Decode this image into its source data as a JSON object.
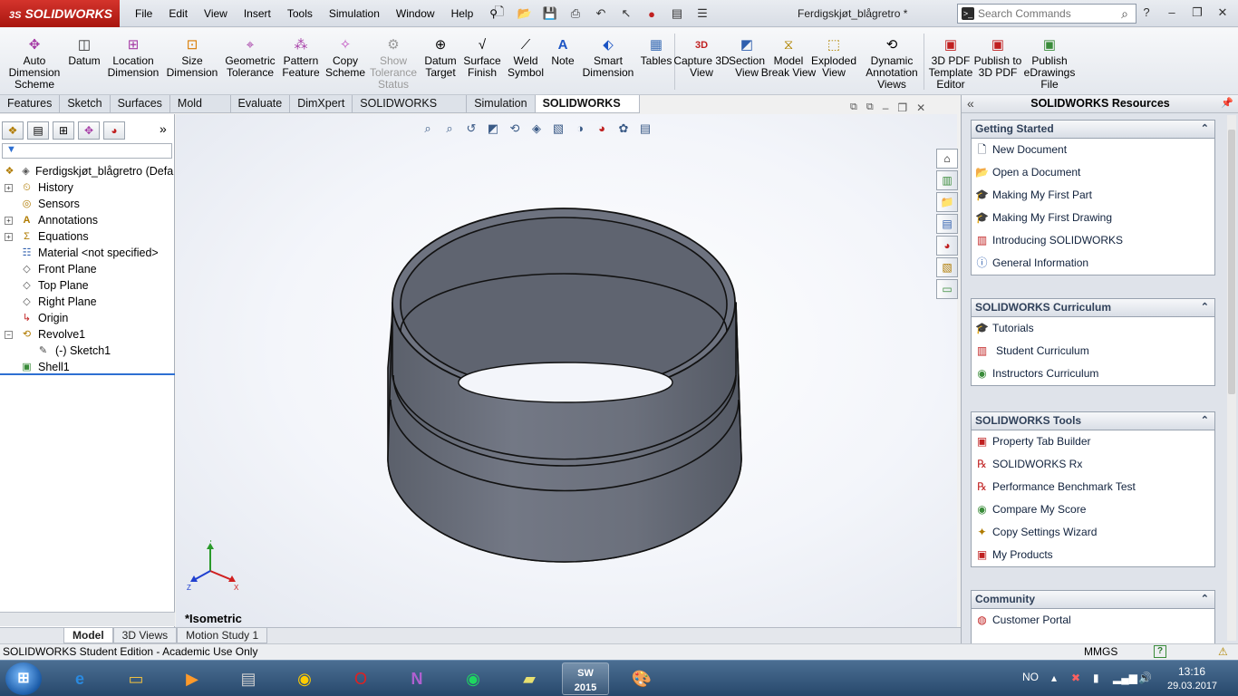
{
  "titlebar": {
    "brand": "SOLIDWORKS",
    "menu": [
      "File",
      "Edit",
      "View",
      "Insert",
      "Tools",
      "Simulation",
      "Window",
      "Help"
    ],
    "document_title": "Ferdigskjøt_blågretro *",
    "search_placeholder": "Search Commands"
  },
  "command_manager": {
    "tools": [
      {
        "label": "Auto Dimension Scheme",
        "icon": "auto-dimension-icon"
      },
      {
        "label": "Datum",
        "icon": "datum-icon"
      },
      {
        "label": "Location Dimension",
        "icon": "location-dimension-icon"
      },
      {
        "label": "Size Dimension",
        "icon": "size-dimension-icon"
      },
      {
        "label": "Geometric Tolerance",
        "icon": "geometric-tolerance-icon"
      },
      {
        "label": "Pattern Feature",
        "icon": "pattern-feature-icon"
      },
      {
        "label": "Copy Scheme",
        "icon": "copy-scheme-icon"
      },
      {
        "label": "Show Tolerance Status",
        "icon": "tolerance-status-icon"
      },
      {
        "label": "Datum Target",
        "icon": "datum-target-icon"
      },
      {
        "label": "Surface Finish",
        "icon": "surface-finish-icon"
      },
      {
        "label": "Weld Symbol",
        "icon": "weld-symbol-icon"
      },
      {
        "label": "Note",
        "icon": "note-icon"
      },
      {
        "label": "Smart Dimension",
        "icon": "smart-dimension-icon"
      },
      {
        "label": "Tables",
        "icon": "tables-icon"
      },
      {
        "label": "Capture 3D View",
        "icon": "capture-3d-view-icon"
      },
      {
        "label": "Section View",
        "icon": "section-view-icon"
      },
      {
        "label": "Model Break View",
        "icon": "model-break-view-icon"
      },
      {
        "label": "Exploded View",
        "icon": "exploded-view-icon"
      },
      {
        "label": "Dynamic Annotation Views",
        "icon": "dynamic-annotation-views-icon"
      },
      {
        "label": "3D PDF Template Editor",
        "icon": "3d-pdf-template-icon"
      },
      {
        "label": "Publish to 3D PDF",
        "icon": "publish-3d-pdf-icon"
      },
      {
        "label": "Publish eDrawings File",
        "icon": "publish-edrawings-icon"
      }
    ]
  },
  "tabs": [
    "Features",
    "Sketch",
    "Surfaces",
    "Mold Tools",
    "Evaluate",
    "DimXpert",
    "SOLIDWORKS Add-Ins",
    "Simulation",
    "SOLIDWORKS MBD"
  ],
  "active_tab": "SOLIDWORKS MBD",
  "feature_tree": {
    "root": "Ferdigskjøt_blågretro  (Defa",
    "items": [
      {
        "label": "History",
        "icon": "history-icon"
      },
      {
        "label": "Sensors",
        "icon": "sensors-icon"
      },
      {
        "label": "Annotations",
        "icon": "annotations-icon"
      },
      {
        "label": "Equations",
        "icon": "equations-icon"
      },
      {
        "label": "Material <not specified>",
        "icon": "material-icon"
      },
      {
        "label": "Front Plane",
        "icon": "plane-icon"
      },
      {
        "label": "Top Plane",
        "icon": "plane-icon"
      },
      {
        "label": "Right Plane",
        "icon": "plane-icon"
      },
      {
        "label": "Origin",
        "icon": "origin-icon"
      },
      {
        "label": "Revolve1",
        "icon": "revolve-icon"
      },
      {
        "label": "(-) Sketch1",
        "icon": "sketch-icon"
      },
      {
        "label": "Shell1",
        "icon": "shell-icon"
      }
    ]
  },
  "graphics": {
    "view_name": "*Isometric",
    "model_color": "#6f7480"
  },
  "bottom_tabs": [
    "Model",
    "3D Views",
    "Motion Study 1"
  ],
  "status": {
    "left": "SOLIDWORKS Student Edition - Academic Use Only",
    "units": "MMGS",
    "help": "?"
  },
  "resources": {
    "title": "SOLIDWORKS Resources",
    "groups": [
      {
        "title": "Getting Started",
        "items": [
          "New Document",
          "Open a Document",
          "Making My First Part",
          "Making My First Drawing",
          "Introducing SOLIDWORKS",
          "General Information"
        ]
      },
      {
        "title": "SOLIDWORKS Curriculum",
        "items": [
          "Tutorials",
          "Student Curriculum",
          "Instructors Curriculum"
        ]
      },
      {
        "title": "SOLIDWORKS Tools",
        "items": [
          "Property Tab Builder",
          "SOLIDWORKS Rx",
          "Performance Benchmark Test",
          "Compare My Score",
          "Copy Settings Wizard",
          "My Products"
        ]
      },
      {
        "title": "Community",
        "items": [
          "Customer Portal"
        ]
      }
    ]
  },
  "taskbar": {
    "language": "NO",
    "time": "13:16",
    "date": "29.03.2017",
    "sw_badge": "2015"
  }
}
